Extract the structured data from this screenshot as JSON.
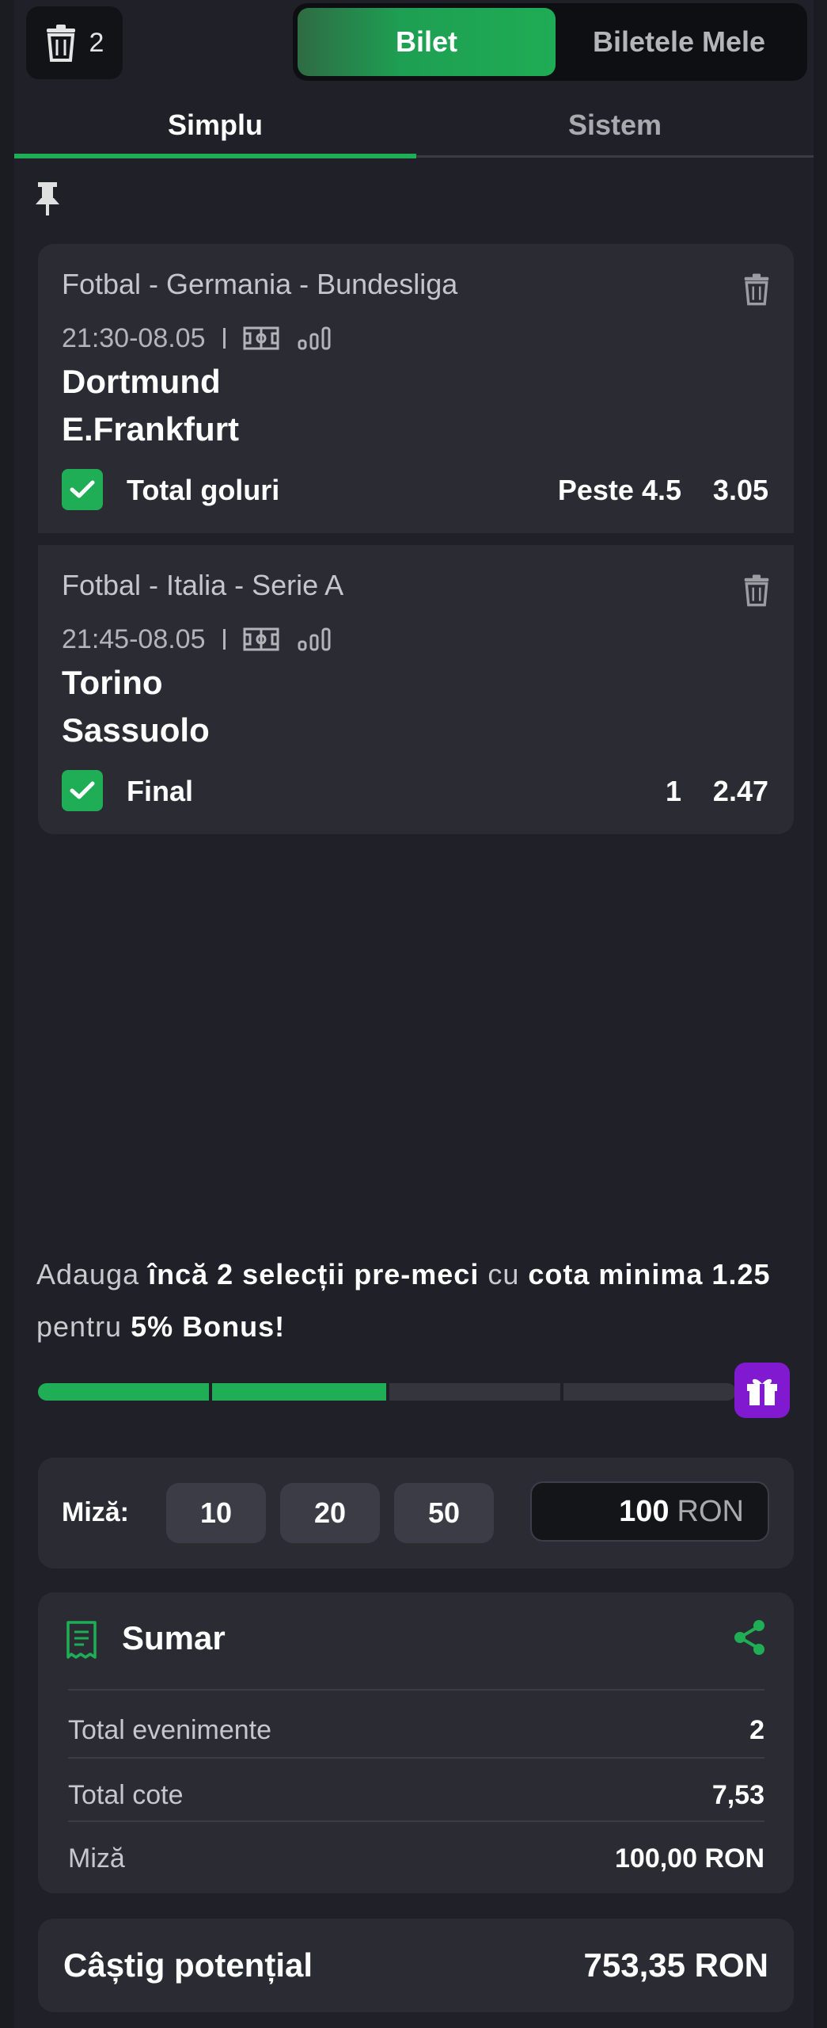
{
  "header": {
    "trash_count": "2",
    "toggle": {
      "active": "Bilet",
      "inactive": "Biletele Mele"
    }
  },
  "tabs": [
    {
      "label": "Simplu"
    },
    {
      "label": "Sistem"
    }
  ],
  "bets": [
    {
      "league": "Fotbal - Germania - Bundesliga",
      "datetime": "21:30-08.05",
      "home": "Dortmund",
      "away": "E.Frankfurt",
      "market": "Total goluri",
      "pick": "Peste 4.5",
      "odd": "3.05"
    },
    {
      "league": "Fotbal - Italia - Serie A",
      "datetime": "21:45-08.05",
      "home": "Torino",
      "away": "Sassuolo",
      "market": "Final",
      "pick": "1",
      "odd": "2.47"
    }
  ],
  "promo": {
    "p1": "Adauga ",
    "p1b": "încă 2 selecții pre-meci",
    "p2": " cu ",
    "p2b": "cota minima 1.25",
    "p3": " pentru ",
    "p3b": "5% Bonus!",
    "progress": 0.5
  },
  "stake": {
    "label": "Miză:",
    "chips": [
      "10",
      "20",
      "50"
    ],
    "amount": "100",
    "currency": "RON"
  },
  "summary": {
    "title": "Sumar",
    "rows": [
      {
        "label": "Total evenimente",
        "value": "2"
      },
      {
        "label": "Total cote",
        "value": "7,53"
      },
      {
        "label": "Miză",
        "value": "100,00 RON"
      }
    ]
  },
  "potential": {
    "label": "Câștig potențial",
    "value": "753,35 RON"
  },
  "colors": {
    "accent": "#1fae56",
    "gift": "#8119d0",
    "background": "#202128",
    "card": "#2a2b33"
  }
}
